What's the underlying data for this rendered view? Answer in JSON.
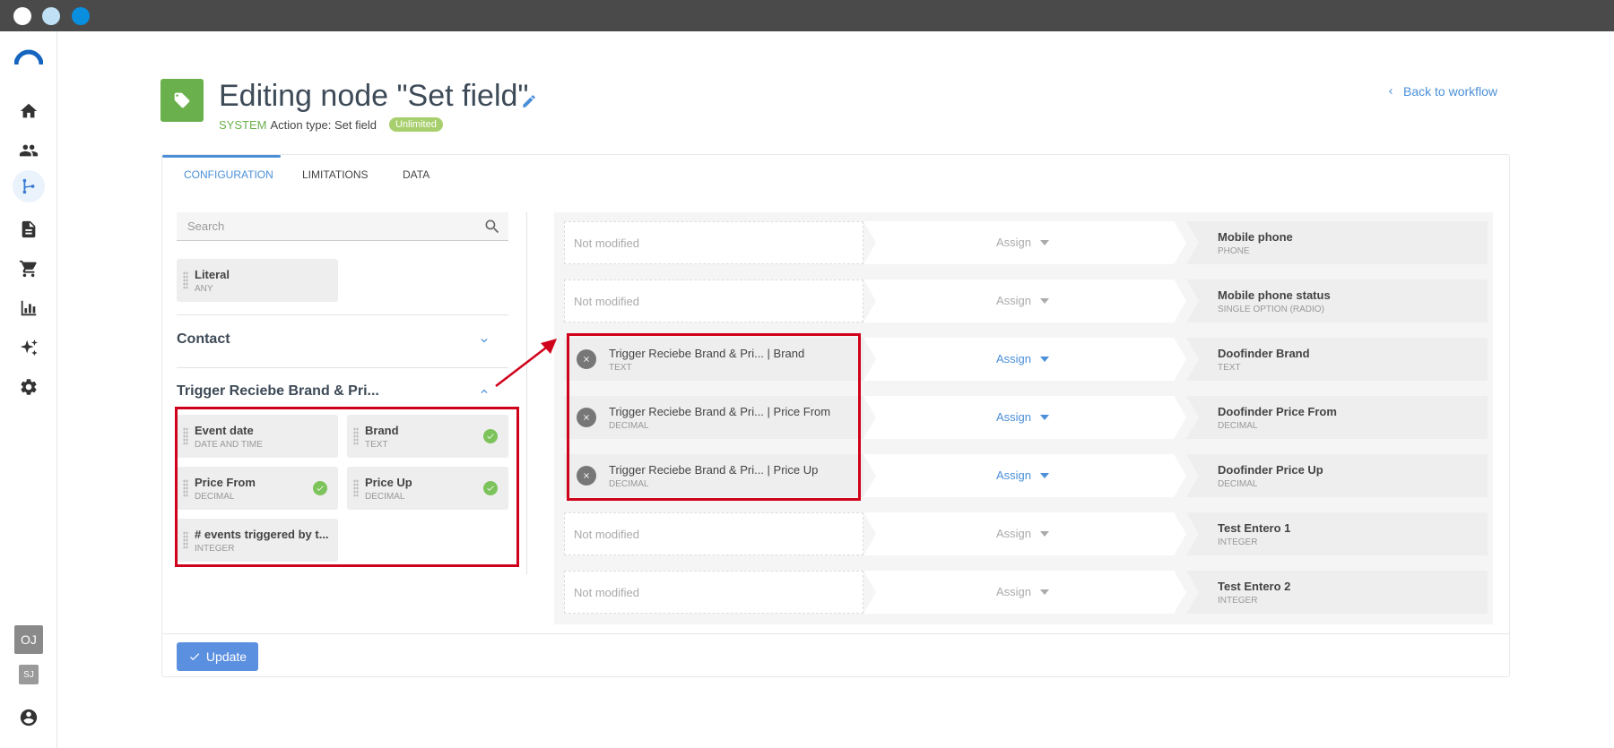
{
  "window": {
    "controls": [
      "close",
      "minimize",
      "maximize"
    ]
  },
  "sidebar": {
    "icons": [
      "home-icon",
      "contacts-icon",
      "workflow-icon",
      "document-icon",
      "cart-icon",
      "chart-icon",
      "sparkle-icon",
      "settings-icon"
    ],
    "active": "workflow-icon",
    "avatars": [
      {
        "initials": "OJ"
      },
      {
        "initials": "SJ"
      }
    ],
    "account_icon": "account-icon"
  },
  "header": {
    "title": "Editing node \"Set field\"",
    "system_label": "SYSTEM",
    "action_type": "Action type: Set field",
    "badge": "Unlimited",
    "back_link": "Back to workflow"
  },
  "tabs": [
    {
      "label": "CONFIGURATION",
      "active": true
    },
    {
      "label": "LIMITATIONS",
      "active": false
    },
    {
      "label": "DATA",
      "active": false
    }
  ],
  "left_panel": {
    "search_placeholder": "Search",
    "literal": {
      "name": "Literal",
      "type": "ANY"
    },
    "sections": [
      {
        "title": "Contact",
        "expanded": false
      },
      {
        "title": "Trigger Reciebe Brand & Pri...",
        "expanded": true
      }
    ],
    "trigger_fields": [
      {
        "name": "Event date",
        "type": "DATE AND TIME",
        "used": false
      },
      {
        "name": "Brand",
        "type": "TEXT",
        "used": true
      },
      {
        "name": "Price From",
        "type": "DECIMAL",
        "used": true
      },
      {
        "name": "Price Up",
        "type": "DECIMAL",
        "used": true
      },
      {
        "name": "# events triggered by t...",
        "type": "INTEGER",
        "used": false
      }
    ]
  },
  "mappings": [
    {
      "source": "Not modified",
      "source_type": "",
      "filled": false,
      "assign": "Assign",
      "target": "Mobile phone",
      "target_type": "PHONE"
    },
    {
      "source": "Not modified",
      "source_type": "",
      "filled": false,
      "assign": "Assign",
      "target": "Mobile phone status",
      "target_type": "SINGLE OPTION (RADIO)"
    },
    {
      "source": "Trigger Reciebe Brand & Pri... | Brand",
      "source_type": "TEXT",
      "filled": true,
      "assign": "Assign",
      "target": "Doofinder Brand",
      "target_type": "TEXT"
    },
    {
      "source": "Trigger Reciebe Brand & Pri... | Price From",
      "source_type": "DECIMAL",
      "filled": true,
      "assign": "Assign",
      "target": "Doofinder Price From",
      "target_type": "DECIMAL"
    },
    {
      "source": "Trigger Reciebe Brand & Pri... | Price Up",
      "source_type": "DECIMAL",
      "filled": true,
      "assign": "Assign",
      "target": "Doofinder Price Up",
      "target_type": "DECIMAL"
    },
    {
      "source": "Not modified",
      "source_type": "",
      "filled": false,
      "assign": "Assign",
      "target": "Test Entero 1",
      "target_type": "INTEGER"
    },
    {
      "source": "Not modified",
      "source_type": "",
      "filled": false,
      "assign": "Assign",
      "target": "Test Entero 2",
      "target_type": "INTEGER"
    }
  ],
  "footer": {
    "update_label": "Update"
  },
  "colors": {
    "accent": "#4a8fd8",
    "brand_green": "#6ab04c",
    "highlight_red": "#d0021b"
  }
}
